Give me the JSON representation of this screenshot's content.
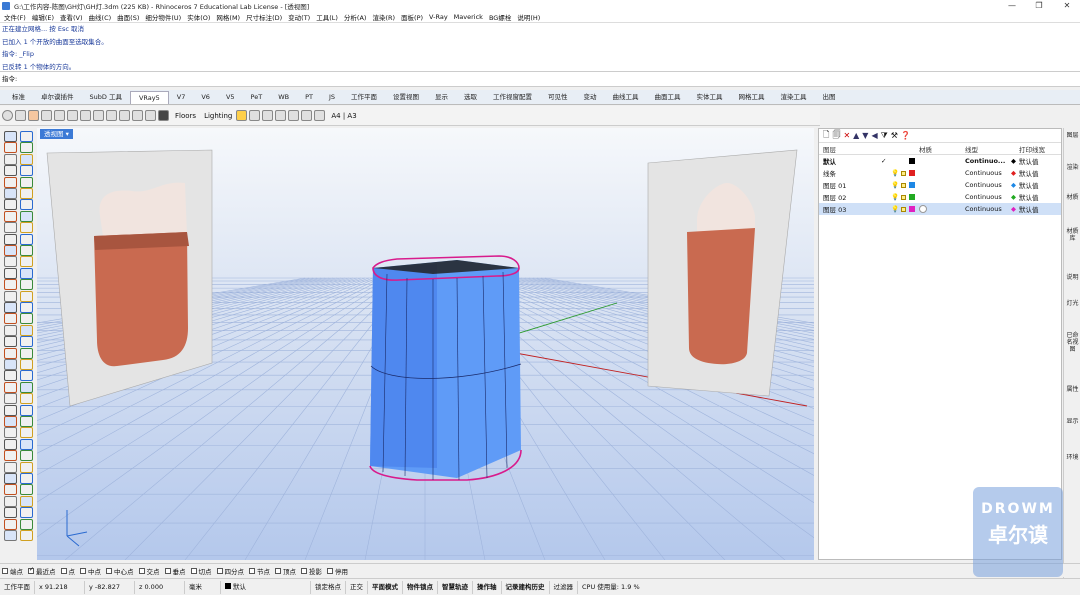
{
  "window": {
    "title": "G:\\工作内容-陈图\\GH灯\\GH灯.3dm (225 KB) - Rhinoceros 7 Educational Lab License - [透视图]",
    "min": "—",
    "max": "❐",
    "close": "✕"
  },
  "menu": [
    "文件(F)",
    "编辑(E)",
    "查看(V)",
    "曲线(C)",
    "曲面(S)",
    "细分物件(U)",
    "实体(O)",
    "网格(M)",
    "尺寸标注(D)",
    "变动(T)",
    "工具(L)",
    "分析(A)",
    "渲染(R)",
    "面板(P)",
    "V-Ray",
    "Maverick",
    "BG螺栓",
    "说明(H)"
  ],
  "command_history": [
    "正在建立网格... 按 Esc 取消",
    "已加入 1 个开放的曲面至选取集合。",
    "指令: _Flip",
    "已反转 1 个物体的方向。"
  ],
  "command_prompt": "指令:",
  "tabs": [
    "标准",
    "卓尔谟插件",
    "SubD 工具",
    "VRay5",
    "V7",
    "V6",
    "V5",
    "PeT",
    "WB",
    "PT",
    "JS",
    "工作平面",
    "设置视图",
    "显示",
    "选取",
    "工作视窗配置",
    "可见性",
    "变动",
    "曲线工具",
    "曲面工具",
    "实体工具",
    "网格工具",
    "渲染工具",
    "出图"
  ],
  "active_tab": "VRay5",
  "toolbar": {
    "floors": "Floors",
    "lighting": "Lighting",
    "paper": "A4 | A3"
  },
  "viewport": {
    "label": "透视图",
    "dropdown": "▾"
  },
  "layers": {
    "headers": {
      "name": "图层",
      "material": "材质",
      "linetype": "线型",
      "printwidth": "打印线宽"
    },
    "rows": [
      {
        "name": "默认",
        "current": "✓",
        "color": "#000000",
        "linetype": "Continuo...",
        "print": "默认值",
        "bold": true,
        "selected": false
      },
      {
        "name": "线条",
        "current": "",
        "color": "#e02020",
        "linetype": "Continuous",
        "print": "默认值",
        "bold": false,
        "selected": false
      },
      {
        "name": "图层 01",
        "current": "",
        "color": "#1e88e5",
        "linetype": "Continuous",
        "print": "默认值",
        "bold": false,
        "selected": false
      },
      {
        "name": "图层 02",
        "current": "",
        "color": "#22aa22",
        "linetype": "Continuous",
        "print": "默认值",
        "bold": false,
        "selected": false
      },
      {
        "name": "图层 03",
        "current": "",
        "color": "#e020c0",
        "linetype": "Continuous",
        "print": "默认值",
        "bold": false,
        "selected": true
      }
    ]
  },
  "right_panels": [
    "图层",
    "渲染",
    "材质",
    "材质库",
    "说明",
    "灯光",
    "已命名视图",
    "属性",
    "显示",
    "环境"
  ],
  "snaps": [
    {
      "label": "端点",
      "on": false
    },
    {
      "label": "最近点",
      "on": true
    },
    {
      "label": "点",
      "on": false
    },
    {
      "label": "中点",
      "on": false
    },
    {
      "label": "中心点",
      "on": false
    },
    {
      "label": "交点",
      "on": false
    },
    {
      "label": "垂点",
      "on": false
    },
    {
      "label": "切点",
      "on": false
    },
    {
      "label": "四分点",
      "on": false
    },
    {
      "label": "节点",
      "on": false
    },
    {
      "label": "顶点",
      "on": false
    },
    {
      "label": "投影",
      "on": false
    },
    {
      "label": "停用",
      "on": false
    }
  ],
  "status": {
    "plane": "工作平面",
    "x": "x 91.218",
    "y": "y -82.827",
    "z": "z 0.000",
    "unit": "毫米",
    "layer": "默认",
    "lock_grid": "锁定格点",
    "ortho": "正交",
    "planar": "平面模式",
    "osnap": "物件锁点",
    "smarttrack": "智慧轨迹",
    "gumball": "操作轴",
    "history": "记录建构历史",
    "filter": "过滤器",
    "cpu": "CPU 使用量: 1.9 %"
  },
  "watermark": {
    "line1": "DROWM",
    "line2": "卓尔谟"
  },
  "colors": {
    "accent": "#3c7ad6",
    "object_blue": "#5a97f5",
    "edge_magenta": "#d81b8c",
    "render_copper": "#c96a50"
  }
}
